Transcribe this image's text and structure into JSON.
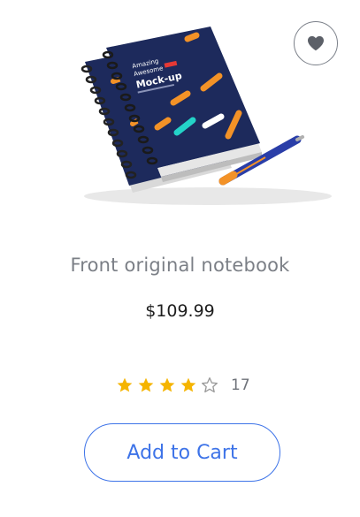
{
  "product": {
    "name": "Front original notebook",
    "price": "$109.99",
    "image_mockup_lines": [
      "Amazing",
      "Awesome",
      "Mock-up"
    ]
  },
  "rating": {
    "value": 4,
    "max": 5,
    "review_count": "17"
  },
  "actions": {
    "add_to_cart_label": "Add to Cart",
    "wishlist_icon": "heart-icon"
  },
  "colors": {
    "accent": "#3d73e8",
    "star_filled": "#f5b400",
    "star_empty": "#9a9a9a",
    "notebook_cover": "#1d2a5c",
    "stripe_orange": "#f39227",
    "stripe_cyan": "#24d3c8"
  }
}
